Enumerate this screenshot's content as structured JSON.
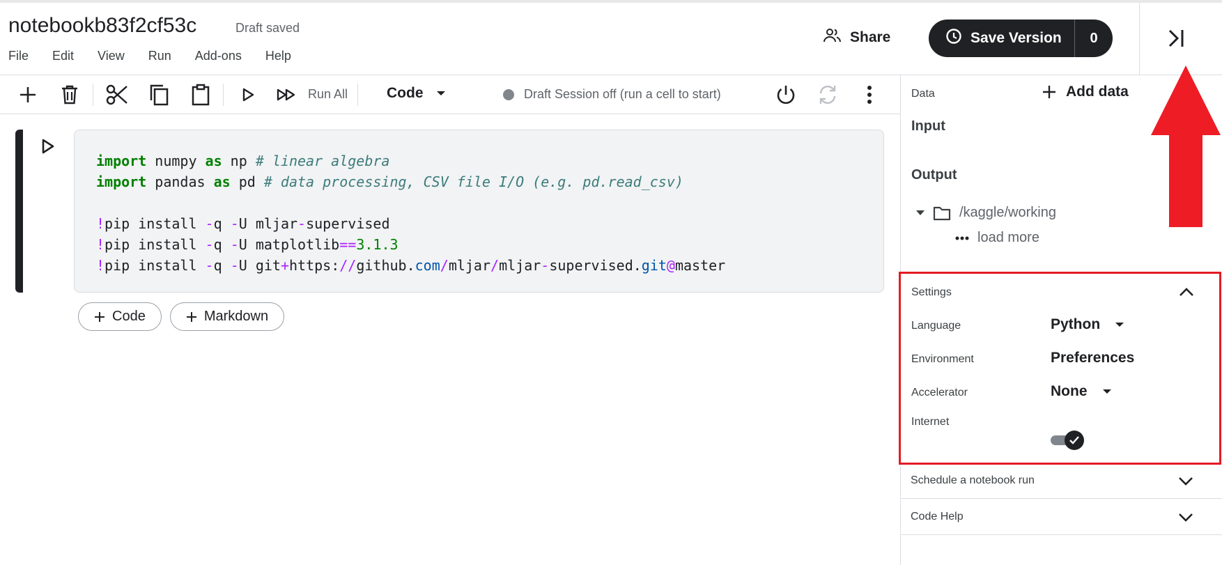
{
  "header": {
    "title": "notebookb83f2cf53c",
    "status": "Draft saved",
    "menu": [
      "File",
      "Edit",
      "View",
      "Run",
      "Add-ons",
      "Help"
    ],
    "share_label": "Share",
    "save_version_label": "Save Version",
    "save_version_count": "0"
  },
  "toolbar": {
    "run_all_label": "Run All",
    "cell_type": "Code",
    "session_status": "Draft Session off (run a cell to start)"
  },
  "cell": {
    "lines": [
      [
        {
          "t": "import",
          "c": "kw"
        },
        {
          "t": " numpy ",
          "c": ""
        },
        {
          "t": "as",
          "c": "kw"
        },
        {
          "t": " np ",
          "c": ""
        },
        {
          "t": "# linear algebra",
          "c": "cm"
        }
      ],
      [
        {
          "t": "import",
          "c": "kw"
        },
        {
          "t": " pandas ",
          "c": ""
        },
        {
          "t": "as",
          "c": "kw"
        },
        {
          "t": " pd ",
          "c": ""
        },
        {
          "t": "# data processing, CSV file I/O (e.g. pd.read_csv)",
          "c": "cm"
        }
      ],
      [],
      [
        {
          "t": "!",
          "c": "op"
        },
        {
          "t": "pip install ",
          "c": ""
        },
        {
          "t": "-",
          "c": "op"
        },
        {
          "t": "q ",
          "c": ""
        },
        {
          "t": "-",
          "c": "op"
        },
        {
          "t": "U mljar",
          "c": ""
        },
        {
          "t": "-",
          "c": "op"
        },
        {
          "t": "supervised",
          "c": ""
        }
      ],
      [
        {
          "t": "!",
          "c": "op"
        },
        {
          "t": "pip install ",
          "c": ""
        },
        {
          "t": "-",
          "c": "op"
        },
        {
          "t": "q ",
          "c": ""
        },
        {
          "t": "-",
          "c": "op"
        },
        {
          "t": "U matplotlib",
          "c": ""
        },
        {
          "t": "==",
          "c": "op"
        },
        {
          "t": "3.1.3",
          "c": "nm"
        }
      ],
      [
        {
          "t": "!",
          "c": "op"
        },
        {
          "t": "pip install ",
          "c": ""
        },
        {
          "t": "-",
          "c": "op"
        },
        {
          "t": "q ",
          "c": ""
        },
        {
          "t": "-",
          "c": "op"
        },
        {
          "t": "U git",
          "c": ""
        },
        {
          "t": "+",
          "c": "op"
        },
        {
          "t": "https:",
          "c": ""
        },
        {
          "t": "//",
          "c": "op"
        },
        {
          "t": "github.",
          "c": ""
        },
        {
          "t": "com",
          "c": "bl"
        },
        {
          "t": "/",
          "c": "op"
        },
        {
          "t": "mljar",
          "c": ""
        },
        {
          "t": "/",
          "c": "op"
        },
        {
          "t": "mljar",
          "c": ""
        },
        {
          "t": "-",
          "c": "op"
        },
        {
          "t": "supervised.",
          "c": ""
        },
        {
          "t": "git",
          "c": "bl"
        },
        {
          "t": "@",
          "c": "op"
        },
        {
          "t": "master",
          "c": ""
        }
      ]
    ],
    "add_code_label": "Code",
    "add_markdown_label": "Markdown"
  },
  "panel": {
    "data_label": "Data",
    "add_data_label": "Add data",
    "input_label": "Input",
    "output_label": "Output",
    "folder_path": "/kaggle/working",
    "load_more_label": "load more",
    "settings_label": "Settings",
    "language_label": "Language",
    "language_value": "Python",
    "environment_label": "Environment",
    "environment_value": "Preferences",
    "accelerator_label": "Accelerator",
    "accelerator_value": "None",
    "internet_label": "Internet",
    "internet_enabled": true,
    "schedule_label": "Schedule a notebook run",
    "code_help_label": "Code Help"
  },
  "colors": {
    "highlight_red": "#e31b23",
    "dark": "#202124",
    "keyword_green": "#008000",
    "comment_teal": "#3d7b7b",
    "operator_purple": "#aa22ff"
  }
}
